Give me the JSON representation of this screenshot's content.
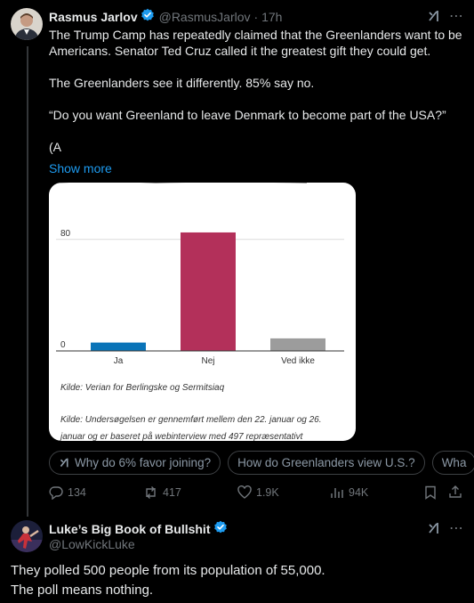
{
  "post": {
    "author_name": "Rasmus Jarlov",
    "handle": "@RasmusJarlov",
    "time": "· 17h",
    "paragraphs": [
      "The Trump Camp has repeatedly claimed that the Greenlanders want to be Americans. Senator Ted Cruz called it the greatest gift they could get.",
      "The Greenlanders see it differently. 85% say no.",
      "“Do you want Greenland to leave Denmark to become part of the USA?”",
      "(A"
    ],
    "show_more": "Show more",
    "card": {
      "source_1": "Kilde: Verian for Berlingske og Sermitsiaq",
      "source_2": "Kilde: Undersøgelsen er gennemført mellem den 22. januar og 26. januar og er baseret på webinterview med 497 repræsentativt"
    },
    "grok_chips": [
      "Why do 6% favor joining?",
      "How do Greenlanders view U.S.?",
      "Wha"
    ],
    "actions": {
      "replies": "134",
      "reposts": "417",
      "likes": "1.9K",
      "views": "94K"
    }
  },
  "reply": {
    "author_name": "Luke’s Big Book of Bullshit",
    "handle": "@LowKickLuke",
    "text": "They polled 500 people from its population of 55,000.\nThe poll means nothing."
  },
  "colors": {
    "accent": "#1d9bf0",
    "verified": "#1d9bf0",
    "bar_ja": "#0a74b8",
    "bar_nej": "#b3305a",
    "bar_vedikke": "#9c9c9c"
  },
  "chart_data": {
    "type": "bar",
    "categories": [
      "Ja",
      "Nej",
      "Ved ikke"
    ],
    "values": [
      6,
      85,
      9
    ],
    "yticks": [
      0,
      80
    ],
    "ylim": [
      0,
      92
    ]
  }
}
